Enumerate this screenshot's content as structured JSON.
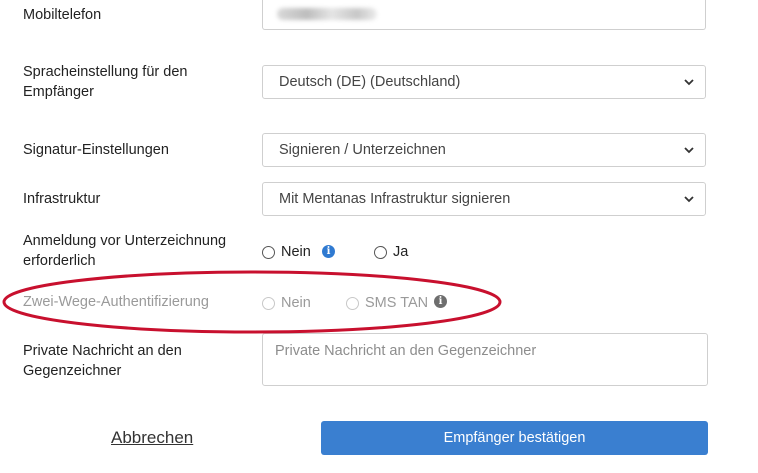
{
  "form": {
    "mobile": {
      "label": "Mobiltelefon"
    },
    "language": {
      "label": "Spracheinstellung für den Empfänger",
      "value": "Deutsch (DE) (Deutschland)"
    },
    "signature": {
      "label": "Signatur-Einstellungen",
      "value": "Signieren / Unterzeichnen"
    },
    "infrastructure": {
      "label": "Infrastruktur",
      "value": "Mit Mentanas Infrastruktur signieren"
    },
    "login_required": {
      "label": "Anmeldung vor Unterzeichnung erforderlich",
      "option_no": "Nein",
      "option_yes": "Ja"
    },
    "two_factor": {
      "label": "Zwei-Wege-Authentifizierung",
      "option_no": "Nein",
      "option_sms": "SMS TAN"
    },
    "private_message": {
      "label": "Private Nachricht an den Gegenzeichner",
      "placeholder": "Private Nachricht an den Gegenzeichner"
    }
  },
  "actions": {
    "cancel_label": "Abbrechen",
    "confirm_label": "Empfänger bestätigen"
  },
  "icons": {
    "info": "info-icon",
    "chevron": "chevron-down-icon"
  },
  "colors": {
    "primary": "#3a7fd0",
    "info_blue": "#2f7ad1",
    "highlight_ellipse": "#c8102e"
  }
}
